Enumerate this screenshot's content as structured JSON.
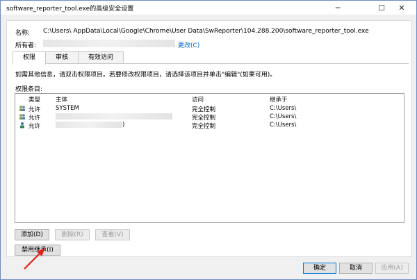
{
  "window": {
    "title": "software_reporter_tool.exe的高级安全设置",
    "controls": {
      "minimize": "─",
      "maximize": "☐",
      "close": "✕"
    }
  },
  "info": {
    "name_label": "名称:",
    "name_value": "C:\\Users\\ AppData\\Local\\Google\\Chrome\\User Data\\SwReporter\\104.288.200\\software_reporter_tool.exe",
    "owner_label": "所有者:",
    "owner_change": "更改(C)"
  },
  "tabs": [
    {
      "label": "权限",
      "active": true
    },
    {
      "label": "审核",
      "active": false
    },
    {
      "label": "有效访问",
      "active": false
    }
  ],
  "instructions": "如需其他信息，请双击权限项目。若要修改权限项目，请选择该项目并单击\"编辑\"(如果可用)。",
  "entries_label": "权限条目:",
  "table": {
    "headers": [
      "类型",
      "主体",
      "访问",
      "继承于"
    ],
    "rows": [
      {
        "type": "允许",
        "principal": "SYSTEM",
        "access": "完全控制",
        "inherited": "C:\\Users\\"
      },
      {
        "type": "允许",
        "principal": "",
        "access": "完全控制",
        "inherited": "C:\\Users\\"
      },
      {
        "type": "允许",
        "principal": ")",
        "access": "完全控制",
        "inherited": "C:\\Users\\"
      }
    ]
  },
  "buttons": {
    "add": "添加(D)",
    "remove": "删除(R)",
    "view": "查看(V)",
    "disable_inheritance": "禁用继承(I)",
    "ok": "确定",
    "cancel": "取消",
    "apply": "应用(A)"
  },
  "colors": {
    "annotation_arrow": "#e0201b",
    "link": "#0066cc"
  }
}
